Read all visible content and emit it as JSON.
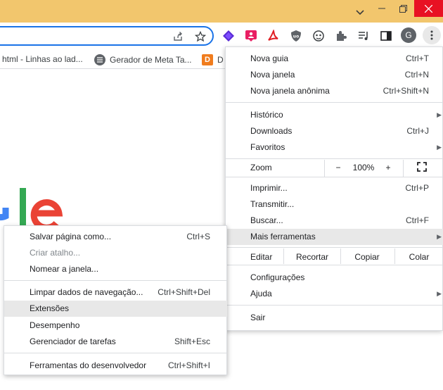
{
  "tabs_bookmarks": [
    {
      "label": "html - Linhas ao lad...",
      "icon": "none"
    },
    {
      "label": "Gerador de Meta Ta...",
      "icon": "list-circle-icon"
    },
    {
      "label": "D",
      "icon": "orange-d-icon"
    }
  ],
  "main_menu": {
    "new_tab": {
      "label": "Nova guia",
      "shortcut": "Ctrl+T"
    },
    "new_window": {
      "label": "Nova janela",
      "shortcut": "Ctrl+N"
    },
    "new_incognito": {
      "label": "Nova janela anônima",
      "shortcut": "Ctrl+Shift+N"
    },
    "history": {
      "label": "Histórico"
    },
    "downloads": {
      "label": "Downloads",
      "shortcut": "Ctrl+J"
    },
    "bookmarks": {
      "label": "Favoritos"
    },
    "zoom": {
      "label": "Zoom",
      "minus": "−",
      "value": "100%",
      "plus": "+"
    },
    "print": {
      "label": "Imprimir...",
      "shortcut": "Ctrl+P"
    },
    "cast": {
      "label": "Transmitir..."
    },
    "find": {
      "label": "Buscar...",
      "shortcut": "Ctrl+F"
    },
    "more_tools": {
      "label": "Mais ferramentas"
    },
    "edit": {
      "label": "Editar",
      "cut": "Recortar",
      "copy": "Copiar",
      "paste": "Colar"
    },
    "settings": {
      "label": "Configurações"
    },
    "help": {
      "label": "Ajuda"
    },
    "exit": {
      "label": "Sair"
    }
  },
  "more_tools_menu": {
    "save_page": {
      "label": "Salvar página como...",
      "shortcut": "Ctrl+S"
    },
    "create_shortcut": {
      "label": "Criar atalho..."
    },
    "name_window": {
      "label": "Nomear a janela..."
    },
    "clear_data": {
      "label": "Limpar dados de navegação...",
      "shortcut": "Ctrl+Shift+Del"
    },
    "extensions": {
      "label": "Extensões"
    },
    "performance": {
      "label": "Desempenho"
    },
    "task_manager": {
      "label": "Gerenciador de tarefas",
      "shortcut": "Shift+Esc"
    },
    "dev_tools": {
      "label": "Ferramentas do desenvolvedor",
      "shortcut": "Ctrl+Shift+I"
    }
  },
  "avatar": {
    "letter": "G"
  },
  "colors": {
    "titlebar": "#f2c66d",
    "highlight": "#e8e8e8",
    "accent": "#1a73e8",
    "close": "#e81123"
  }
}
